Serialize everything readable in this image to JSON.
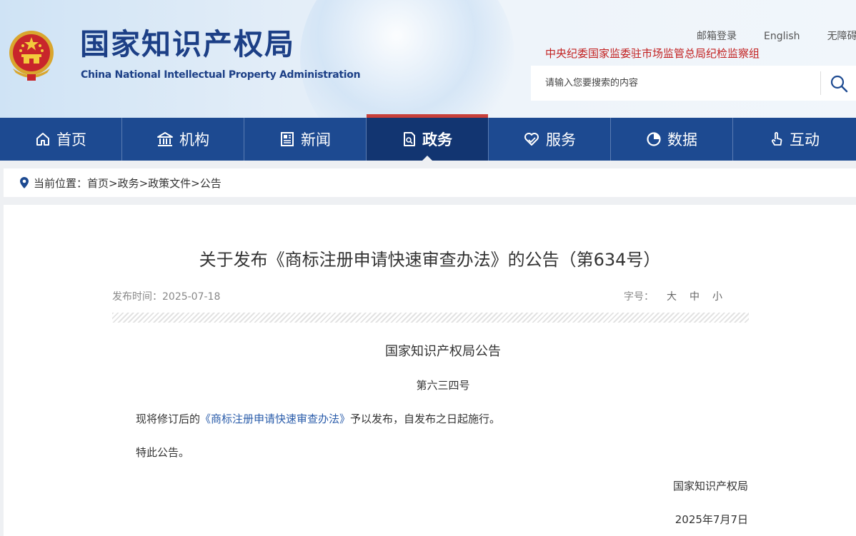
{
  "header": {
    "site_name_cn": "国家知识产权局",
    "site_name_en": "China National Intellectual Property Administration",
    "top_links": [
      "邮箱登录",
      "English",
      "无障碍"
    ],
    "discipline_link": "中央纪委国家监委驻市场监管总局纪检监察组",
    "search_placeholder": "请输入您要搜索的内容"
  },
  "nav": {
    "items": [
      {
        "label": "首页",
        "icon": "home-icon"
      },
      {
        "label": "机构",
        "icon": "building-icon"
      },
      {
        "label": "新闻",
        "icon": "newspaper-icon"
      },
      {
        "label": "政务",
        "icon": "document-icon"
      },
      {
        "label": "服务",
        "icon": "heart-hand-icon"
      },
      {
        "label": "数据",
        "icon": "pie-chart-icon"
      },
      {
        "label": "互动",
        "icon": "pointer-hand-icon"
      }
    ],
    "active": "政务"
  },
  "breadcrumb": {
    "label": "当前位置：",
    "path": "首页>政务>政策文件>公告"
  },
  "article": {
    "title": "关于发布《商标注册申请快速审查办法》的公告（第634号）",
    "publish_date": "发布时间：2025-07-18",
    "font_size_label": "字号：",
    "font_sizes": [
      "大",
      "中",
      "小"
    ],
    "doc_header": "国家知识产权局公告",
    "doc_number": "第六三四号",
    "para1_before": "现将修订后的",
    "para1_link": "《商标注册申请快速审查办法》",
    "para1_after": "予以发布，自发布之日起施行。",
    "para2": "特此公告。",
    "signature": "国家知识产权局",
    "sign_date": "2025年7月7日"
  },
  "colors": {
    "nav_bg": "#1d4a91",
    "nav_active": "#123571",
    "brand_blue": "#1c3f86",
    "discipline_red": "#c21f1f",
    "link_blue": "#2a5caa"
  }
}
